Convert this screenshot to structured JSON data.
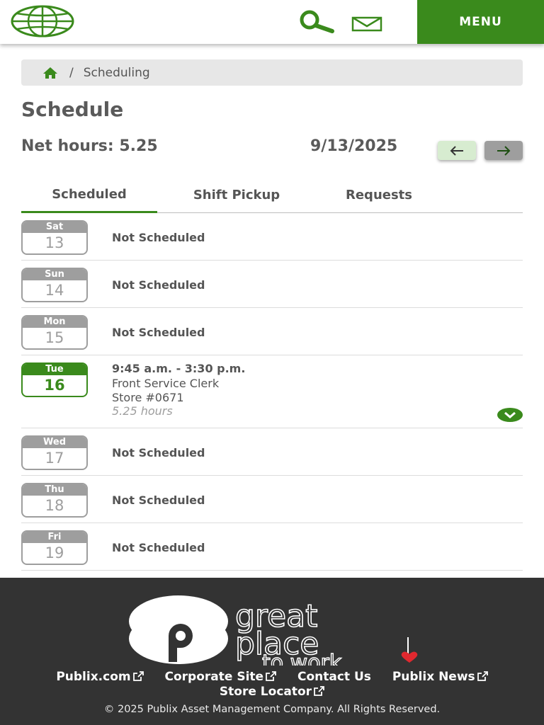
{
  "header": {
    "menu_label": "MENU",
    "brand_color": "#3a8a1c"
  },
  "breadcrumb": {
    "separator": "/",
    "current": "Scheduling"
  },
  "page": {
    "title": "Schedule",
    "net_hours": "Net hours: 5.25",
    "date": "9/13/2025"
  },
  "tabs": [
    {
      "label": "Scheduled",
      "active": true
    },
    {
      "label": "Shift Pickup",
      "active": false
    },
    {
      "label": "Requests",
      "active": false
    }
  ],
  "days": [
    {
      "day": "Sat",
      "date": "13",
      "status": "Not Scheduled"
    },
    {
      "day": "Sun",
      "date": "14",
      "status": "Not Scheduled"
    },
    {
      "day": "Mon",
      "date": "15",
      "status": "Not Scheduled"
    },
    {
      "day": "Tue",
      "date": "16",
      "shift": {
        "time": "9:45 a.m. - 3:30 p.m.",
        "position": "Front Service Clerk",
        "store": "Store #0671",
        "hours": "5.25 hours"
      }
    },
    {
      "day": "Wed",
      "date": "17",
      "status": "Not Scheduled"
    },
    {
      "day": "Thu",
      "date": "18",
      "status": "Not Scheduled"
    },
    {
      "day": "Fri",
      "date": "19",
      "status": "Not Scheduled"
    }
  ],
  "footer": {
    "links": [
      {
        "label": "Publix.com",
        "external": true
      },
      {
        "label": "Corporate Site",
        "external": true
      },
      {
        "label": "Contact Us",
        "external": false
      },
      {
        "label": "Publix News",
        "external": true
      },
      {
        "label": "Store Locator",
        "external": true
      }
    ],
    "copyright": "© 2025 Publix Asset Management Company. All Rights Reserved.",
    "logo_text": "great place to work"
  }
}
